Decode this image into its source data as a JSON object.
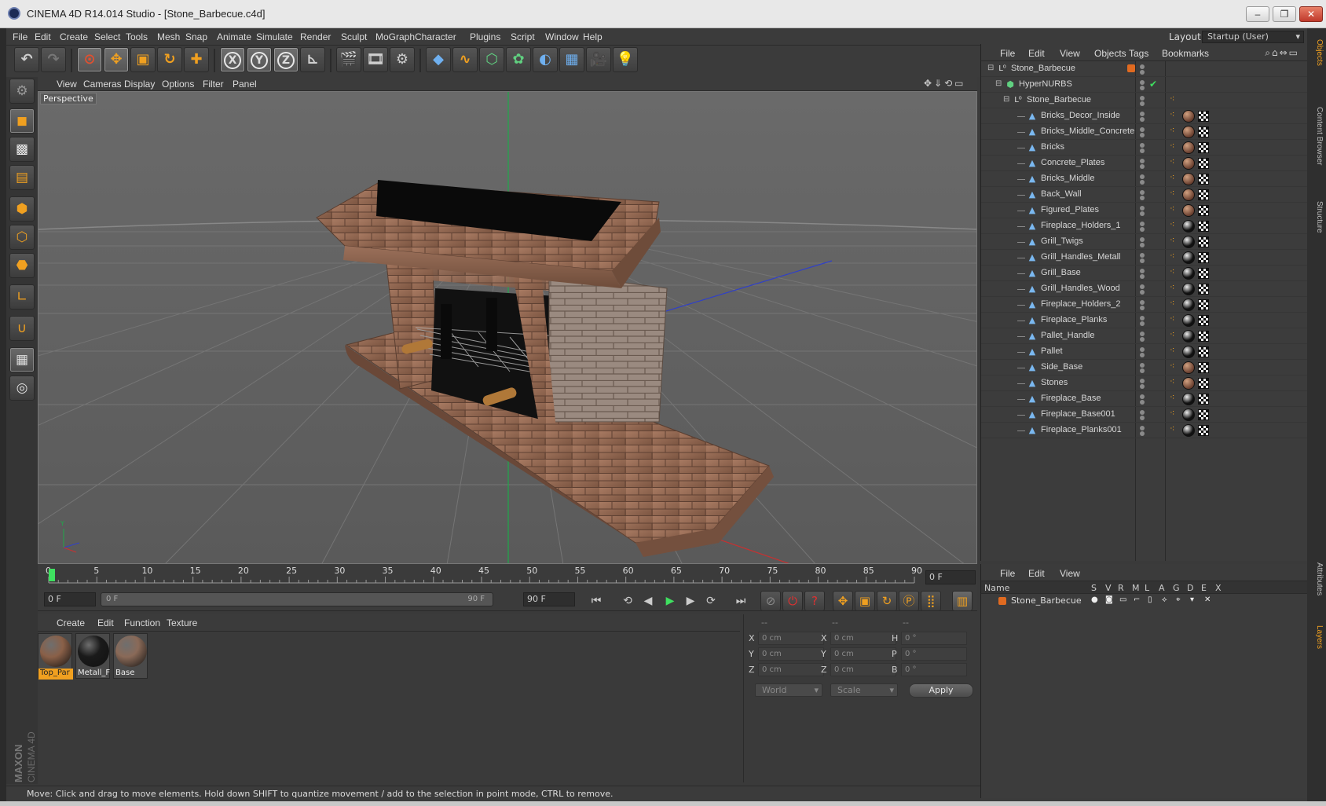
{
  "window": {
    "title": "CINEMA 4D R14.014 Studio - [Stone_Barbecue.c4d]",
    "minimize": "–",
    "restore": "❐",
    "close": "✕"
  },
  "menubar": {
    "items": [
      "File",
      "Edit",
      "Create",
      "Select",
      "Tools",
      "Mesh",
      "Snap",
      "Animate",
      "Simulate",
      "Render",
      "Sculpt",
      "MoGraph",
      "Character",
      "Plugins",
      "Script",
      "Window",
      "Help"
    ],
    "layout_label": "Layout:",
    "layout_value": "Startup (User)"
  },
  "viewport": {
    "menu": [
      "View",
      "Cameras",
      "Display",
      "Options",
      "Filter",
      "Panel"
    ],
    "label": "Perspective"
  },
  "timeline": {
    "ticks": [
      "0",
      "5",
      "10",
      "15",
      "20",
      "25",
      "30",
      "35",
      "40",
      "45",
      "50",
      "55",
      "60",
      "65",
      "70",
      "75",
      "80",
      "85",
      "90"
    ],
    "frame_field": "0 F",
    "start_field": "0 F",
    "range_start": "0 F",
    "range_end": "90 F",
    "end_field": "90 F"
  },
  "materials": {
    "menu": [
      "Create",
      "Edit",
      "Function",
      "Texture"
    ],
    "items": [
      {
        "label": "Top_Par",
        "selected": true,
        "color": "#8a6048"
      },
      {
        "label": "Metall_F",
        "selected": false,
        "color": "#1a1a1a"
      },
      {
        "label": "Base",
        "selected": false,
        "color": "#8a6a58"
      }
    ]
  },
  "coordinates": {
    "headers": [
      "--",
      "--",
      "--"
    ],
    "rows": [
      {
        "a": "X",
        "av": "0 cm",
        "b": "X",
        "bv": "0 cm",
        "c": "H",
        "cv": "0 °"
      },
      {
        "a": "Y",
        "av": "0 cm",
        "b": "Y",
        "bv": "0 cm",
        "c": "P",
        "cv": "0 °"
      },
      {
        "a": "Z",
        "av": "0 cm",
        "b": "Z",
        "bv": "0 cm",
        "c": "B",
        "cv": "0 °"
      }
    ],
    "world": "World",
    "scale": "Scale",
    "apply": "Apply"
  },
  "status": "Move: Click and drag to move elements. Hold down SHIFT to quantize movement / add to the selection in point mode, CTRL to remove.",
  "objects": {
    "menu": [
      "File",
      "Edit",
      "View",
      "Objects",
      "Tags",
      "Bookmarks"
    ],
    "tree": [
      {
        "name": "Stone_Barbecue",
        "depth": 0,
        "kind": "null"
      },
      {
        "name": "HyperNURBS",
        "depth": 1,
        "kind": "nurbs"
      },
      {
        "name": "Stone_Barbecue",
        "depth": 2,
        "kind": "null"
      },
      {
        "name": "Bricks_Decor_Inside",
        "depth": 3,
        "kind": "mesh",
        "mat": "brick"
      },
      {
        "name": "Bricks_Middle_Concrete",
        "depth": 3,
        "kind": "mesh",
        "mat": "brick"
      },
      {
        "name": "Bricks",
        "depth": 3,
        "kind": "mesh",
        "mat": "brick"
      },
      {
        "name": "Concrete_Plates",
        "depth": 3,
        "kind": "mesh",
        "mat": "brick"
      },
      {
        "name": "Bricks_Middle",
        "depth": 3,
        "kind": "mesh",
        "mat": "brick"
      },
      {
        "name": "Back_Wall",
        "depth": 3,
        "kind": "mesh",
        "mat": "brick"
      },
      {
        "name": "Figured_Plates",
        "depth": 3,
        "kind": "mesh",
        "mat": "brick"
      },
      {
        "name": "Fireplace_Holders_1",
        "depth": 3,
        "kind": "mesh",
        "mat": "metal"
      },
      {
        "name": "Grill_Twigs",
        "depth": 3,
        "kind": "mesh",
        "mat": "metal"
      },
      {
        "name": "Grill_Handles_Metall",
        "depth": 3,
        "kind": "mesh",
        "mat": "metal"
      },
      {
        "name": "Grill_Base",
        "depth": 3,
        "kind": "mesh",
        "mat": "metal"
      },
      {
        "name": "Grill_Handles_Wood",
        "depth": 3,
        "kind": "mesh",
        "mat": "metal"
      },
      {
        "name": "Fireplace_Holders_2",
        "depth": 3,
        "kind": "mesh",
        "mat": "metal"
      },
      {
        "name": "Fireplace_Planks",
        "depth": 3,
        "kind": "mesh",
        "mat": "metal"
      },
      {
        "name": "Pallet_Handle",
        "depth": 3,
        "kind": "mesh",
        "mat": "metal"
      },
      {
        "name": "Pallet",
        "depth": 3,
        "kind": "mesh",
        "mat": "metal"
      },
      {
        "name": "Side_Base",
        "depth": 3,
        "kind": "mesh",
        "mat": "brick"
      },
      {
        "name": "Stones",
        "depth": 3,
        "kind": "mesh",
        "mat": "brick"
      },
      {
        "name": "Fireplace_Base",
        "depth": 3,
        "kind": "mesh",
        "mat": "metal"
      },
      {
        "name": "Fireplace_Base001",
        "depth": 3,
        "kind": "mesh",
        "mat": "metal"
      },
      {
        "name": "Fireplace_Planks001",
        "depth": 3,
        "kind": "mesh",
        "mat": "metal"
      }
    ]
  },
  "side_tabs": [
    "Objects",
    "Content Browser",
    "Structure",
    "Attributes",
    "Layers"
  ],
  "layers": {
    "menu": [
      "File",
      "Edit",
      "View"
    ],
    "columns": [
      "Name",
      "S",
      "V",
      "R",
      "M",
      "L",
      "A",
      "G",
      "D",
      "E",
      "X"
    ],
    "rows": [
      {
        "name": "Stone_Barbecue"
      }
    ]
  },
  "colors": {
    "accent": "#f0a020",
    "panel": "#3b3b3b",
    "viewport_bg": "#5a5a5a"
  }
}
